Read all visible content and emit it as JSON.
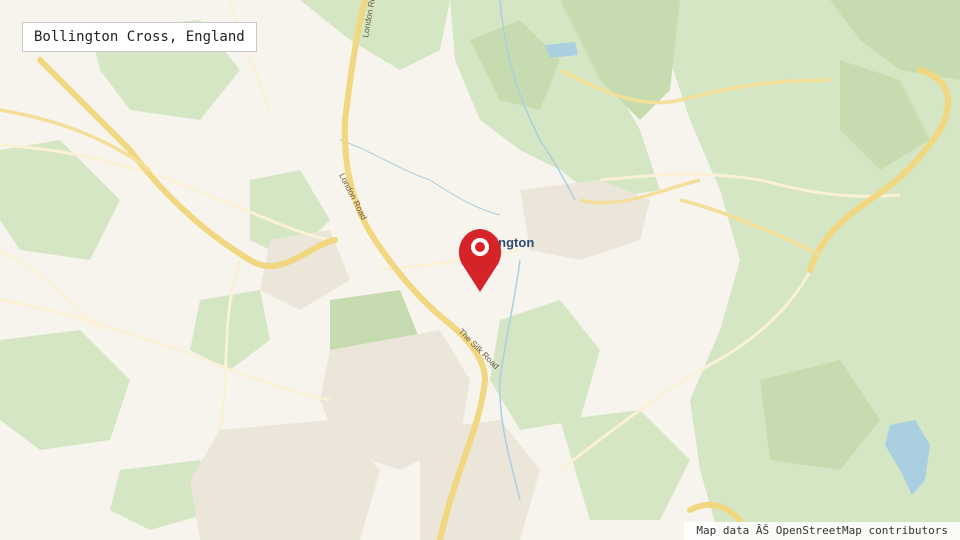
{
  "title": "Bollington Cross, England",
  "attribution": "Map data ÂŠ OpenStreetMap contributors",
  "labels": {
    "town": "Bollington",
    "london_road_top": "London Road",
    "london_road": "London Road",
    "silk_road": "The Silk Road"
  },
  "marker": {
    "icon": "map-pin-icon",
    "color": "#d6232a"
  },
  "colors": {
    "background": "#f7f4ee",
    "green": "#d5e6c4",
    "green_dark": "#c6dcb0",
    "road_major": "#f1d77f",
    "road_minor": "#fbf1d6",
    "water": "#a9cfe0",
    "urban": "#ebe5da",
    "text_town": "#2f4d6e"
  }
}
